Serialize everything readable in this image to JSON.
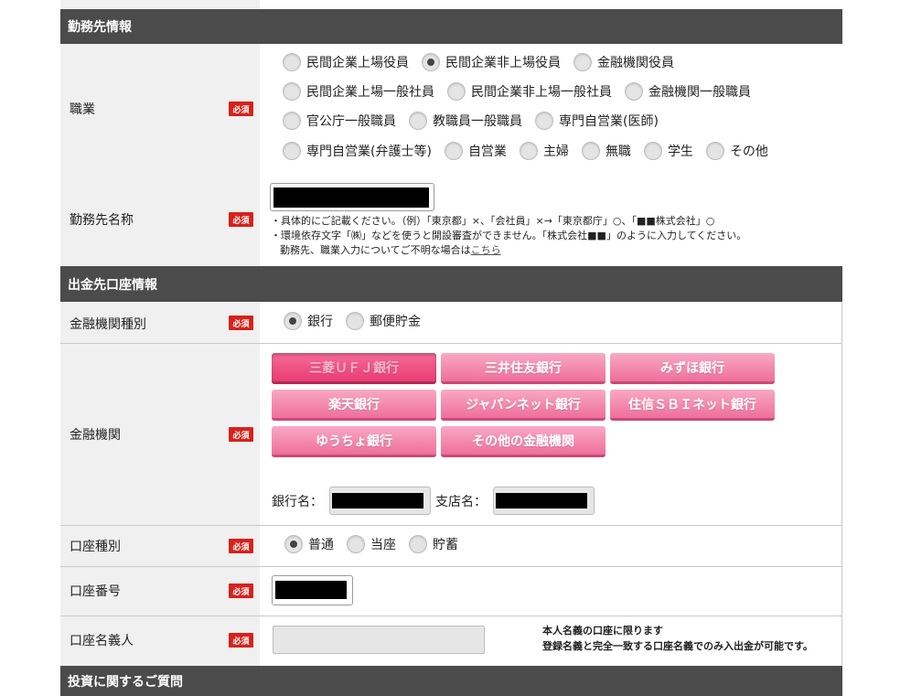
{
  "sections": {
    "employer": "勤務先情報",
    "withdrawal_account": "出金先口座情報",
    "investment_questions": "投資に関するご質問"
  },
  "required_badge": "必須",
  "occupation": {
    "label": "職業",
    "rows": [
      [
        {
          "label": "民間企業上場役員",
          "checked": false
        },
        {
          "label": "民間企業非上場役員",
          "checked": true
        },
        {
          "label": "金融機関役員",
          "checked": false
        }
      ],
      [
        {
          "label": "民間企業上場一般社員",
          "checked": false
        },
        {
          "label": "民間企業非上場一般社員",
          "checked": false
        },
        {
          "label": "金融機関一般職員",
          "checked": false
        }
      ],
      [
        {
          "label": "官公庁一般職員",
          "checked": false
        },
        {
          "label": "教職員一般職員",
          "checked": false
        },
        {
          "label": "専門自営業(医師)",
          "checked": false
        }
      ],
      [
        {
          "label": "専門自営業(弁護士等)",
          "checked": false
        },
        {
          "label": "自営業",
          "checked": false
        },
        {
          "label": "主婦",
          "checked": false
        },
        {
          "label": "無職",
          "checked": false
        },
        {
          "label": "学生",
          "checked": false
        },
        {
          "label": "その他",
          "checked": false
        }
      ]
    ]
  },
  "employer_name": {
    "label": "勤務先名称",
    "note1": "・具体的にご記載ください。（例）「東京都」×、「会社員」×→「東京都庁」○、「■■株式会社」○",
    "note2": "・環境依存文字「㈱」などを使うと開設審査ができません。「株式会社■■」のように入力してください。",
    "note3": "勤務先、職業入力についてご不明な場合は",
    "note3_link": "こちら"
  },
  "institution_type": {
    "label": "金融機関種別",
    "options": [
      {
        "label": "銀行",
        "checked": true
      },
      {
        "label": "郵便貯金",
        "checked": false
      }
    ]
  },
  "institution": {
    "label": "金融機関",
    "banks": [
      "三菱ＵＦＪ銀行",
      "三井住友銀行",
      "みずほ銀行",
      "楽天銀行",
      "ジャパンネット銀行",
      "住信ＳＢＩネット銀行",
      "ゆうちょ銀行",
      "その他の金融機関"
    ],
    "selected_bank": "三菱ＵＦＪ銀行",
    "bank_name_label": "銀行名：",
    "branch_name_label": "支店名："
  },
  "account_type": {
    "label": "口座種別",
    "options": [
      {
        "label": "普通",
        "checked": true
      },
      {
        "label": "当座",
        "checked": false
      },
      {
        "label": "貯蓄",
        "checked": false
      }
    ]
  },
  "account_number": {
    "label": "口座番号"
  },
  "account_holder": {
    "label": "口座名義人",
    "info1": "本人名義の口座に限ります",
    "info2": "登録名義と完全一致する口座名義でのみ入出金が可能です。"
  },
  "colors": {
    "header_bg": "#4b4b4b",
    "required": "#d8211a",
    "bank_button": "#ef6f9a"
  }
}
